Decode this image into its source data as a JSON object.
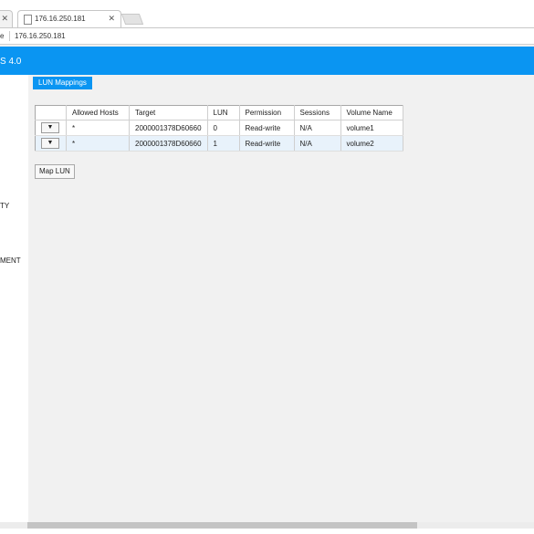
{
  "browser": {
    "active_tab_title": "176.16.250.181",
    "address_prefix": "e",
    "address_url": "176.16.250.181"
  },
  "app": {
    "title_fragment": "S 4.0",
    "sidebar": {
      "items": [
        "TY",
        "MENT"
      ]
    },
    "tabs": {
      "lun_mappings": "LUN Mappings"
    },
    "table": {
      "columns": [
        "Allowed Hosts",
        "Target",
        "LUN",
        "Permission",
        "Sessions",
        "Volume Name"
      ],
      "rows": [
        {
          "allowed_hosts": "*",
          "target": "2000001378D60660",
          "lun": "0",
          "permission": "Read-write",
          "sessions": "N/A",
          "volume_name": "volume1"
        },
        {
          "allowed_hosts": "*",
          "target": "2000001378D60660",
          "lun": "1",
          "permission": "Read-write",
          "sessions": "N/A",
          "volume_name": "volume2"
        }
      ],
      "row_button_glyph": "▼"
    },
    "map_lun_label": "Map LUN"
  },
  "colors": {
    "accent": "#0a95f2",
    "row_alt": "#e8f2fb"
  }
}
